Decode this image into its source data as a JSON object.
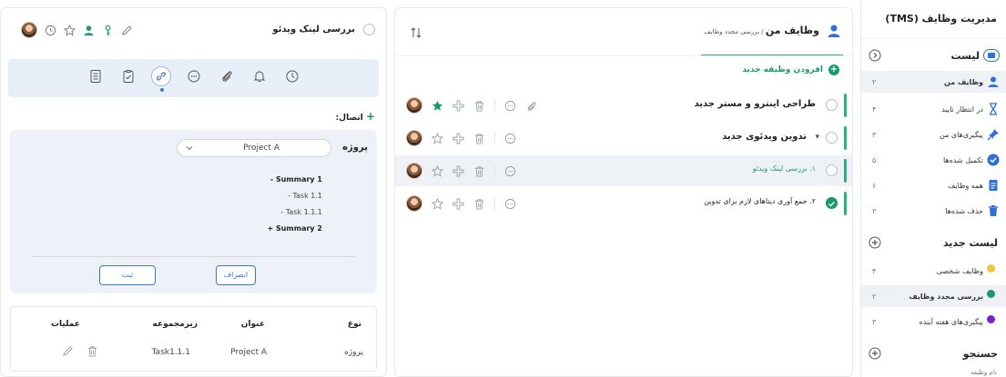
{
  "sidebar": {
    "title": "مدیریت وظایف (TMS)",
    "list_section": {
      "label": "لیست"
    },
    "list_items": [
      {
        "label": "وظایف من",
        "count": "۲",
        "icon": "person-icon",
        "color": "#2f6fd6"
      },
      {
        "label": "در انتظار تایید",
        "count": "۴",
        "icon": "hourglass-icon",
        "color": "#2f6fd6"
      },
      {
        "label": "پیگیری‌های من",
        "count": "۳",
        "icon": "pin-icon",
        "color": "#2f6fd6"
      },
      {
        "label": "تکمیل شده‌ها",
        "count": "۵",
        "icon": "check-circle-icon",
        "color": "#2f6fd6"
      },
      {
        "label": "همه وظایف",
        "count": "۶",
        "icon": "document-icon",
        "color": "#2f6fd6"
      },
      {
        "label": "حذف شده‌ها",
        "count": "۳",
        "icon": "trash-icon",
        "color": "#2f6fd6"
      }
    ],
    "new_list_section": {
      "label": "لیست جدید"
    },
    "new_list_items": [
      {
        "label": "وظایف شخصی",
        "count": "۴",
        "color": "#f5c242"
      },
      {
        "label": "بررسی مجدد وظایف",
        "count": "۲",
        "color": "#1a9a6b"
      },
      {
        "label": "پیگیری‌های هفته آینده",
        "count": "۳",
        "color": "#7b22d3"
      }
    ],
    "search_section": {
      "label": "جستجو"
    },
    "search_hint": "نام وظیفه"
  },
  "middle": {
    "title": "وظایف من",
    "breadcrumb": " / بررسی مجدد وظایف",
    "add_task_label": "افزودن وظیفه جدید",
    "tasks": [
      {
        "name": "طراحی اینترو و مستر جدید",
        "starred": true
      },
      {
        "name": "تدوین ویدئوی جدید",
        "starred": false
      },
      {
        "name": "۱.  بررسی لینک ویدئو",
        "starred": false
      },
      {
        "name": "۲.  جمع آوری دیتاهای لازم برای تدوین",
        "starred": false
      }
    ]
  },
  "detail": {
    "task_title": "بررسی لینک ویدئو",
    "connection_label": "اتصال:",
    "form": {
      "project_label": "پروژه",
      "project_value": "Project A",
      "tree": [
        {
          "text": "Summary 1 -",
          "bold": true
        },
        {
          "text": "Task 1.1 -",
          "bold": false
        },
        {
          "text": "Task 1.1.1 -",
          "bold": false
        },
        {
          "text": "Summary 2 +",
          "bold": true
        }
      ],
      "submit_label": "ثبت",
      "cancel_label": "انصراف"
    },
    "table": {
      "headers": {
        "type": "نوع",
        "title": "عنوان",
        "subset": "زیرمجموعه",
        "ops": "عملیات"
      },
      "row": {
        "type": "پروژه",
        "title": "Project A",
        "subset": "Task1.1.1"
      }
    }
  },
  "colors": {
    "accent_green": "#1a9a6b",
    "accent_blue": "#3778d6",
    "tab_bg": "#e9eff8",
    "form_bg": "#eef2f8"
  }
}
